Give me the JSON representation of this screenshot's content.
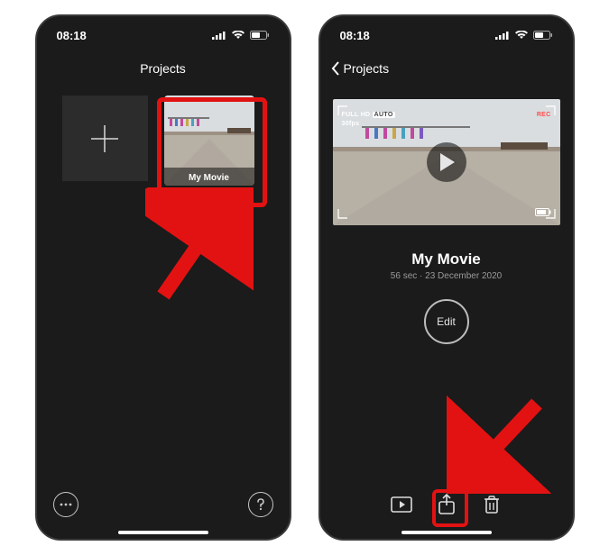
{
  "screen1": {
    "time": "08:18",
    "title": "Projects",
    "movie_label": "My Movie"
  },
  "screen2": {
    "time": "08:18",
    "back_label": "Projects",
    "movie_title": "My Movie",
    "movie_meta": "56 sec · 23 December 2020",
    "edit_label": "Edit",
    "video_fullhd": "FULL HD",
    "video_auto": "AUTO",
    "video_fps": "30fps",
    "video_rec": "REC"
  }
}
